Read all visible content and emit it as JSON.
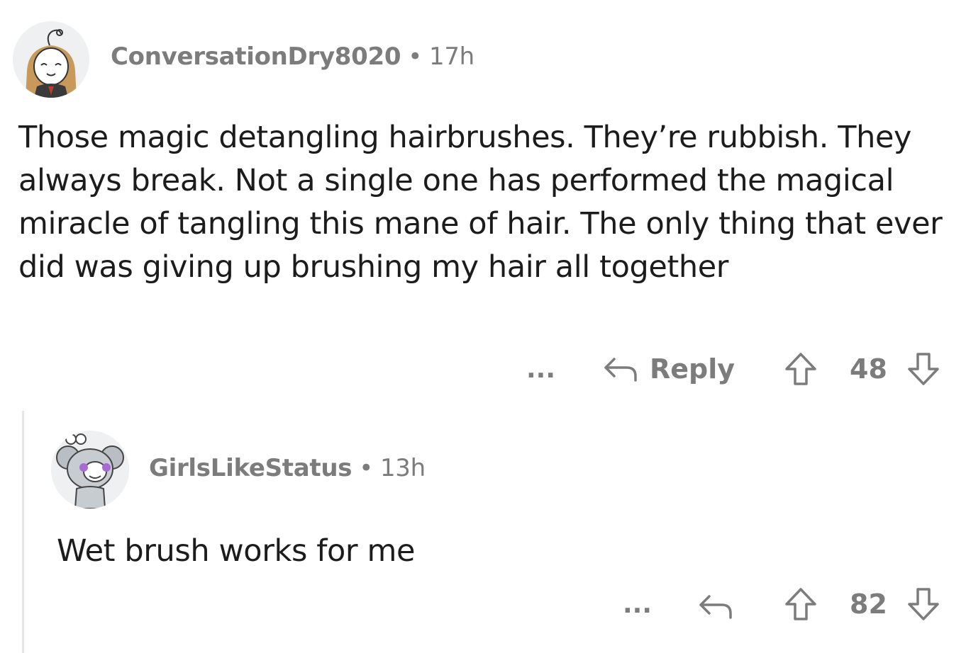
{
  "comments": [
    {
      "username": "ConversationDry8020",
      "separator": "•",
      "time": "17h",
      "body": "Those magic detangling hairbrushes. They’re rubbish. They always break. Not a single one has performed the magical miracle of tangling this mane of hair. The only thing that ever did was giving up brushing my hair all together",
      "more_label": "...",
      "reply_label": "Reply",
      "votes": "48"
    },
    {
      "username": "GirlsLikeStatus",
      "separator": "•",
      "time": "13h",
      "body": "Wet brush works for me",
      "more_label": "...",
      "votes": "82"
    }
  ],
  "colors": {
    "meta_text": "#7c7c7c",
    "body_text": "#1c1c1c",
    "thread_line": "#e6e6e6",
    "avatar_bg": "#eef0f2",
    "icon_stroke": "#7c7c7c"
  },
  "icons": {
    "reply": "reply-arrow-icon",
    "upvote": "upvote-arrow-icon",
    "downvote": "downvote-arrow-icon",
    "more": "more-options-icon"
  }
}
